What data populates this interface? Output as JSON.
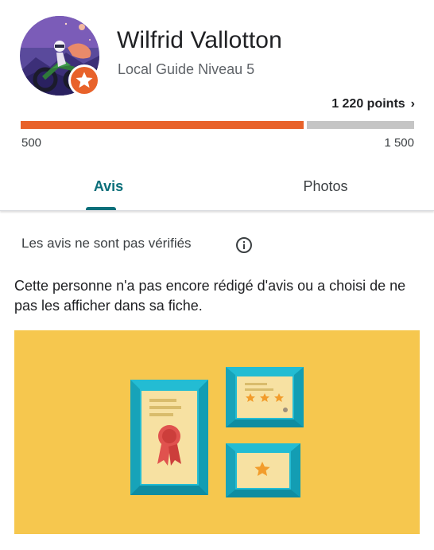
{
  "profile": {
    "name": "Wilfrid Vallotton",
    "level": "Local Guide Niveau 5",
    "avatar": "motocross-rider-avatar",
    "badge": "local-guide-star-badge"
  },
  "points": {
    "label": "1 220 points",
    "chevron": "›",
    "current": 1220,
    "min_label": "500",
    "max_label": "1 500",
    "progress_fraction": 0.72
  },
  "tabs": [
    {
      "label": "Avis",
      "active": true
    },
    {
      "label": "Photos",
      "active": false
    }
  ],
  "reviews": {
    "notice": "Les avis ne sont pas vérifiés",
    "info_icon": "info-icon",
    "empty_message": "Cette personne n'a pas encore rédigé d'avis ou a choisi de ne pas les afficher dans sa fiche.",
    "illustration": "framed-certificates-illustration"
  },
  "colors": {
    "accent_teal": "#0b6f7a",
    "progress_orange": "#e8622a",
    "progress_track": "#c5c5c5",
    "illustration_bg": "#f6c74e",
    "frame_blue": "#22b8cf"
  }
}
